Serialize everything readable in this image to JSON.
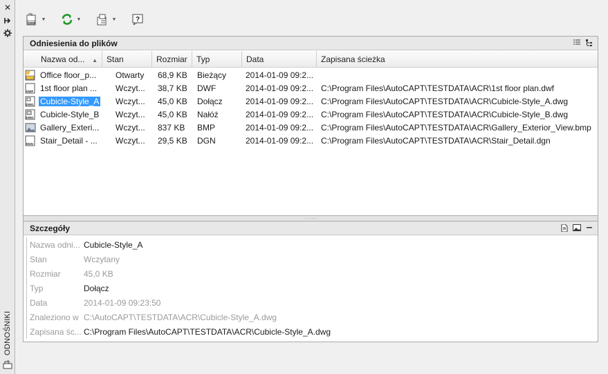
{
  "strip": {
    "title": "ODNOŚNIKI",
    "close_icon": "close-icon",
    "pin_icon": "autohide-icon",
    "props_icon": "properties-icon"
  },
  "toolbar": {
    "buttons": [
      {
        "name": "attach-button",
        "icon": "attach-dwg-icon"
      },
      {
        "name": "refresh-button",
        "icon": "refresh-icon"
      },
      {
        "name": "change-path-button",
        "icon": "change-path-icon"
      },
      {
        "name": "help-button",
        "icon": "help-icon",
        "label": "?"
      }
    ]
  },
  "files_panel": {
    "title": "Odniesienia do plików",
    "columns": [
      "Nazwa od...",
      "Stan",
      "Rozmiar",
      "Typ",
      "Data",
      "Zapisana ścieżka"
    ],
    "rows": [
      {
        "name": "Office floor_p...",
        "stan": "Otwarty",
        "size": "68,9 KB",
        "typ": "Bieżący",
        "date": "2014-01-09 09:2...",
        "path": "",
        "icon": "dwg-current-icon"
      },
      {
        "name": "1st floor plan ...",
        "stan": "Wczyt...",
        "size": "38,7 KB",
        "typ": "DWF",
        "date": "2014-01-09 09:2...",
        "path": "C:\\Program Files\\AutoCAPT\\TESTDATA\\ACR\\1st floor plan.dwf",
        "icon": "dwf-icon"
      },
      {
        "name": "Cubicle-Style_A",
        "stan": "Wczyt...",
        "size": "45,0 KB",
        "typ": "Dołącz",
        "date": "2014-01-09 09:2...",
        "path": "C:\\Program Files\\AutoCAPT\\TESTDATA\\ACR\\Cubicle-Style_A.dwg",
        "icon": "dwg-icon",
        "selected": true
      },
      {
        "name": "Cubicle-Style_B",
        "stan": "Wczyt...",
        "size": "45,0 KB",
        "typ": "Nałóż",
        "date": "2014-01-09 09:2...",
        "path": "C:\\Program Files\\AutoCAPT\\TESTDATA\\ACR\\Cubicle-Style_B.dwg",
        "icon": "dwg-overlay-icon"
      },
      {
        "name": "Gallery_Exteri...",
        "stan": "Wczyt...",
        "size": "837 KB",
        "typ": "BMP",
        "date": "2014-01-09 09:2...",
        "path": "C:\\Program Files\\AutoCAPT\\TESTDATA\\ACR\\Gallery_Exterior_View.bmp",
        "icon": "image-icon"
      },
      {
        "name": "Stair_Detail - ...",
        "stan": "Wczyt...",
        "size": "29,5 KB",
        "typ": "DGN",
        "date": "2014-01-09 09:2...",
        "path": "C:\\Program Files\\AutoCAPT\\TESTDATA\\ACR\\Stair_Detail.dgn",
        "icon": "dgn-icon"
      }
    ]
  },
  "details_panel": {
    "title": "Szczegóły",
    "rows": [
      {
        "label": "Nazwa odni...",
        "value": "Cubicle-Style_A",
        "dim": false
      },
      {
        "label": "Stan",
        "value": "Wczytany",
        "dim": true
      },
      {
        "label": "Rozmiar",
        "value": "45,0 KB",
        "dim": true
      },
      {
        "label": "Typ",
        "value": "Dołącz",
        "dim": false
      },
      {
        "label": "Data",
        "value": "2014-01-09 09:23:50",
        "dim": true
      },
      {
        "label": "Znaleziono w",
        "value": "C:\\AutoCAPT\\TESTDATA\\ACR\\Cubicle-Style_A.dwg",
        "dim": true
      },
      {
        "label": "Zapisana śc...",
        "value": "C:\\Program Files\\AutoCAPT\\TESTDATA\\ACR\\Cubicle-Style_A.dwg",
        "dim": false
      }
    ]
  },
  "colors": {
    "selection": "#3399ff",
    "refresh_green": "#1e9a2a"
  }
}
